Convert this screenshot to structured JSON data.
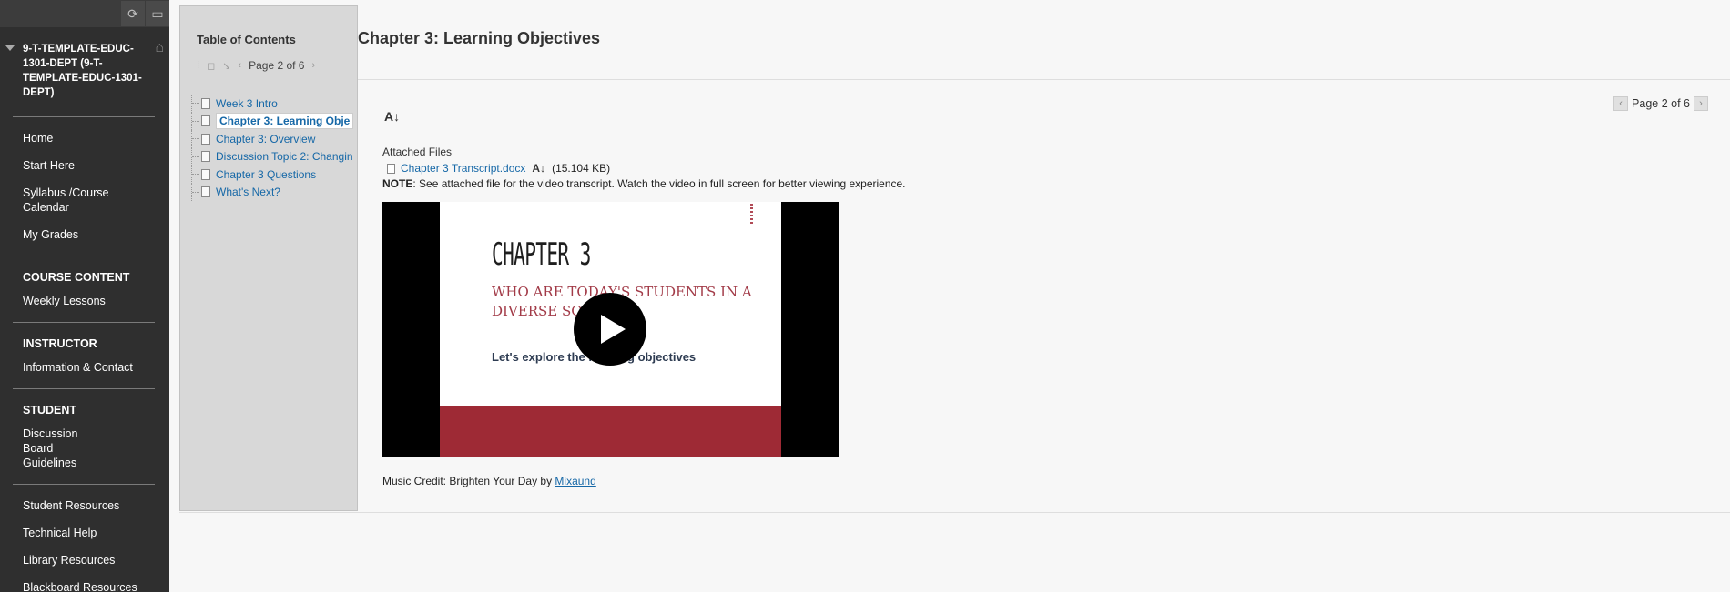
{
  "course_menu": {
    "course_title": "9-T-TEMPLATE-EDUC-1301-DEPT (9-T-TEMPLATE-EDUC-1301-DEPT)",
    "top_links": [
      "Home",
      "Start Here",
      "Syllabus /Course Calendar",
      "My Grades"
    ],
    "course_content": {
      "heading": "COURSE CONTENT",
      "items": [
        "Weekly Lessons"
      ]
    },
    "instructor": {
      "heading": "INSTRUCTOR",
      "items": [
        "Information & Contact"
      ]
    },
    "student": {
      "heading": "STUDENT",
      "items": [
        "Discussion Board Guidelines"
      ]
    },
    "resources": [
      "Student Resources",
      "Technical Help",
      "Library Resources",
      "Blackboard Resources"
    ]
  },
  "toc": {
    "title": "Table of Contents",
    "pager_text": "Page 2 of 6",
    "items": [
      {
        "label": "Week 3 Intro"
      },
      {
        "label": "Chapter 3: Learning Obje"
      },
      {
        "label": "Chapter 3: Overview"
      },
      {
        "label": "Discussion Topic 2: Changin"
      },
      {
        "label": "Chapter 3 Questions"
      },
      {
        "label": "What's Next?"
      }
    ]
  },
  "content": {
    "page_title": "Chapter 3: Learning Objectives",
    "pager_text": "Page 2 of 6",
    "attached_files_label": "Attached Files",
    "attachment": {
      "name": "Chapter 3 Transcript.docx",
      "size": "(15.104 KB)"
    },
    "note_label": "NOTE",
    "note_text": ": See attached file for the video transcript. Watch the video in full screen for better viewing experience.",
    "video_slide": {
      "chapter": "CHAPTER 3",
      "subtitle": "WHO ARE TODAY'S STUDENTS IN A DIVERSE SOCIETY?",
      "explore": "Let's explore the learning objectives"
    },
    "credit_text": "Music Credit: Brighten Your Day by ",
    "credit_link": "Mixaund"
  },
  "colors": {
    "menu_bg": "#2f2f2f",
    "link": "#1668a7",
    "slide_band": "#9e2a35"
  }
}
